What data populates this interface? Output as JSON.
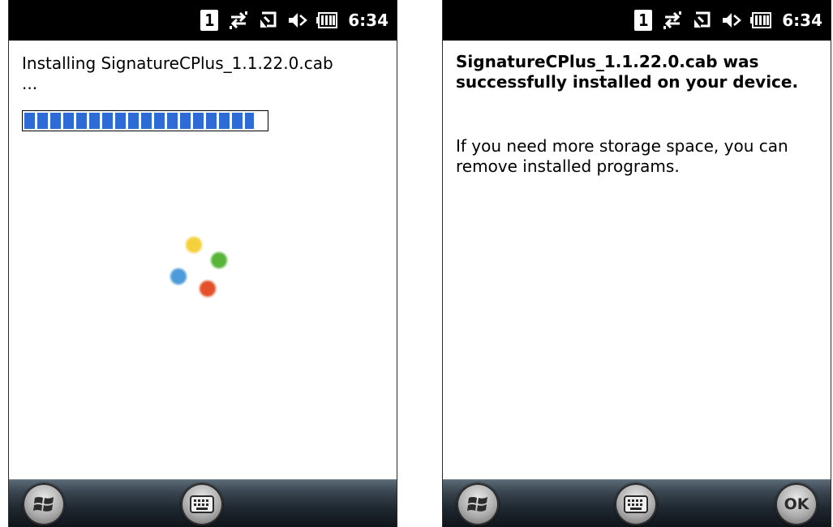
{
  "status_bar": {
    "slot_number": "1",
    "time": "6:34",
    "icons": [
      "slot-number-icon",
      "connectivity-icon",
      "sync-icon",
      "speaker-icon",
      "battery-icon"
    ]
  },
  "left_screen": {
    "installing_text": "Installing SignatureCPlus_1.1.22.0.cab",
    "ellipsis": "...",
    "progress": 0.95,
    "spinner_colors": [
      "#f5d23c",
      "#59b53a",
      "#4b9cd8",
      "#e4502a"
    ]
  },
  "right_screen": {
    "success_message": "SignatureCPlus_1.1.22.0.cab was successfully installed on your device.",
    "storage_message": "If you need more storage space, you can remove installed programs."
  },
  "taskbar": {
    "start_icon": "windows-start-icon",
    "keyboard_icon": "keyboard-icon",
    "ok_label": "OK"
  },
  "colors": {
    "progress_fill": "#2e6bd6",
    "status_bar_bg": "#000000",
    "taskbar_bg": "#1f2830"
  }
}
